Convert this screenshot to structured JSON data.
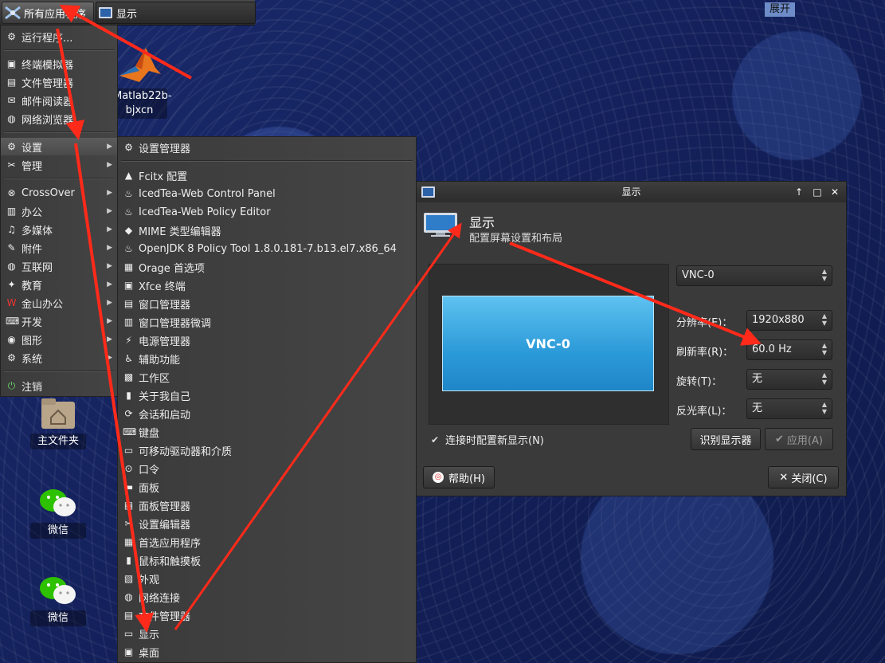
{
  "panel": {
    "apps_button": "所有应用程序",
    "task_display": "显示",
    "expand": "展开"
  },
  "desktop_icons": [
    {
      "label": "Matlab22b-\nbjxcn",
      "icon": "matlab-icon"
    },
    {
      "label": "主文件夹",
      "icon": "home-folder-icon"
    },
    {
      "label": "微信",
      "icon": "wechat-icon"
    },
    {
      "label": "微信",
      "icon": "wechat-icon"
    }
  ],
  "main_menu": {
    "run": "运行程序...",
    "items_top": [
      "终端模拟器",
      "文件管理器",
      "邮件阅读器",
      "网络浏览器"
    ],
    "settings": "设置",
    "manage": "管理",
    "categories": [
      "CrossOver",
      "办公",
      "多媒体",
      "附件",
      "互联网",
      "教育",
      "金山办公",
      "开发",
      "图形",
      "系统"
    ],
    "logout": "注销"
  },
  "settings_menu": {
    "manager": "设置管理器",
    "items": [
      "Fcitx 配置",
      "IcedTea-Web Control Panel",
      "IcedTea-Web Policy Editor",
      "MIME 类型编辑器",
      "OpenJDK 8 Policy Tool 1.8.0.181-7.b13.el7.x86_64",
      "Orage 首选项",
      "Xfce 终端",
      "窗口管理器",
      "窗口管理器微调",
      "电源管理器",
      "辅助功能",
      "工作区",
      "关于我自己",
      "会话和启动",
      "键盘",
      "可移动驱动器和介质",
      "口令",
      "面板",
      "面板管理器",
      "设置编辑器",
      "首选应用程序",
      "鼠标和触摸板",
      "外观",
      "网络连接",
      "文件管理器",
      "显示",
      "桌面"
    ]
  },
  "dialog": {
    "title": "显示",
    "header_title": "显示",
    "header_subtitle": "配置屏幕设置和布局",
    "monitor_name": "VNC-0",
    "output_select": "VNC-0",
    "labels": {
      "resolution": "分辨率(E)：",
      "refresh": "刷新率(R)：",
      "rotation": "旋转(T)：",
      "reflection": "反光率(L)："
    },
    "values": {
      "resolution": "1920x880",
      "refresh": "60.0 Hz",
      "rotation": "无",
      "reflection": "无"
    },
    "checkbox_label": "连接时配置新显示(N)",
    "checkbox_checked": true,
    "identify_button": "识别显示器",
    "apply_button": "应用(A)",
    "help_button": "帮助(H)",
    "close_button": "关闭(C)"
  },
  "colors": {
    "annotation_arrow": "#ff2a1a",
    "monitor_blue": "#2b9ad8"
  }
}
